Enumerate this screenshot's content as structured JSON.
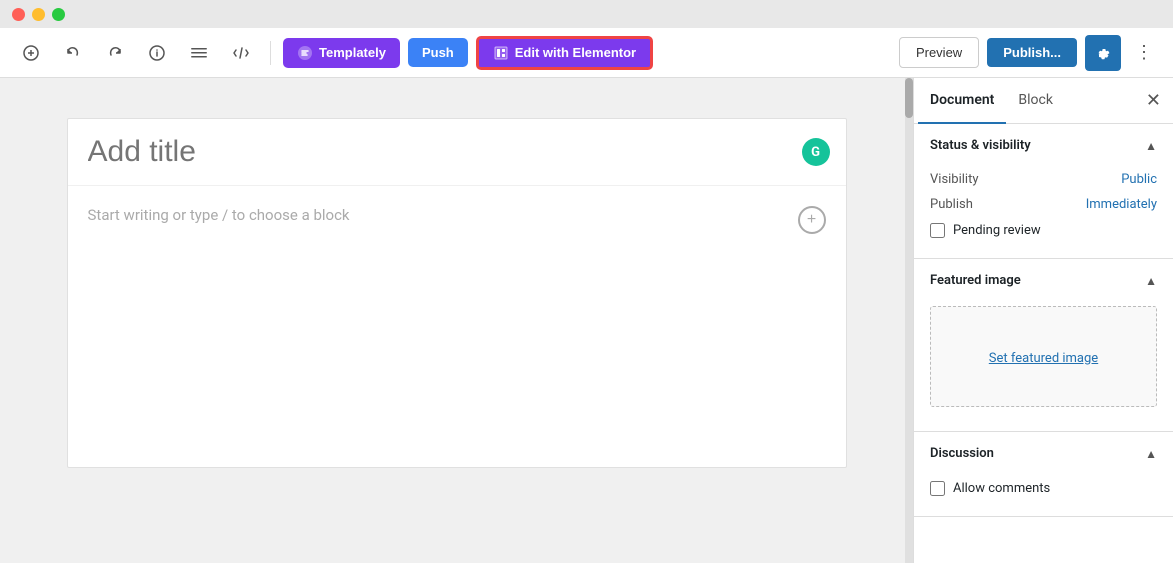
{
  "titlebar": {
    "traffic_lights": [
      "red",
      "yellow",
      "green"
    ]
  },
  "toolbar": {
    "add_label": "+",
    "undo_label": "↩",
    "redo_label": "↪",
    "info_label": "ℹ",
    "list_label": "☰",
    "pen_label": "✎",
    "templately_label": "Templately",
    "push_label": "Push",
    "elementor_label": "Edit with Elementor",
    "preview_label": "Preview",
    "publish_label": "Publish...",
    "settings_label": "⚙",
    "more_label": "⋮"
  },
  "editor": {
    "title_placeholder": "Add title",
    "body_placeholder": "Start writing or type / to choose a block"
  },
  "sidebar": {
    "tab_document": "Document",
    "tab_block": "Block",
    "close_label": "✕",
    "status_visibility": {
      "title": "Status & visibility",
      "visibility_label": "Visibility",
      "visibility_value": "Public",
      "publish_label": "Publish",
      "publish_value": "Immediately",
      "pending_review_label": "Pending review",
      "pending_review_checked": false
    },
    "featured_image": {
      "title": "Featured image",
      "set_label": "Set featured image"
    },
    "discussion": {
      "title": "Discussion",
      "allow_comments_label": "Allow comments",
      "allow_comments_checked": false
    }
  }
}
